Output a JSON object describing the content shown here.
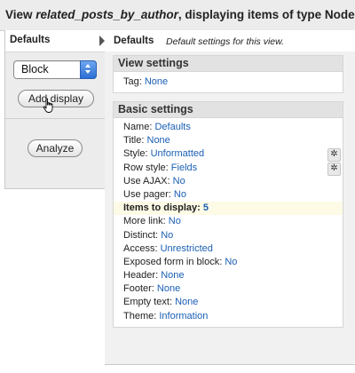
{
  "title": {
    "prefix": "View ",
    "view_name": "related_posts_by_author",
    "suffix": ", displaying items of type Node"
  },
  "left_panel": {
    "tab_label": "Defaults",
    "display_select_value": "Block",
    "add_display_label": "Add display",
    "analyze_label": "Analyze"
  },
  "main": {
    "header_bold": "Defaults",
    "header_desc": "Default settings for this view.",
    "view_settings": {
      "heading": "View settings",
      "rows": [
        {
          "label": "Tag: ",
          "value": "None"
        }
      ]
    },
    "basic_settings": {
      "heading": "Basic settings",
      "rows": [
        {
          "label": "Name: ",
          "value": "Defaults"
        },
        {
          "label": "Title: ",
          "value": "None"
        },
        {
          "label": "Style: ",
          "value": "Unformatted"
        },
        {
          "label": "Row style: ",
          "value": "Fields"
        },
        {
          "label": "Use AJAX: ",
          "value": "No"
        },
        {
          "label": "Use pager: ",
          "value": "No"
        },
        {
          "label": "Items to display: ",
          "value": "5"
        },
        {
          "label": "More link: ",
          "value": "No"
        },
        {
          "label": "Distinct: ",
          "value": "No"
        },
        {
          "label": "Access: ",
          "value": "Unrestricted"
        },
        {
          "label": "Exposed form in block: ",
          "value": "No"
        },
        {
          "label": "Header: ",
          "value": "None"
        },
        {
          "label": "Footer: ",
          "value": "None"
        },
        {
          "label": "Empty text: ",
          "value": "None"
        },
        {
          "label": "Theme: ",
          "value": "Information"
        }
      ]
    }
  },
  "icons": {
    "gear": "gear-icon",
    "tab_arrow": "triangle-right-icon",
    "cursor": "hand-pointer-icon"
  },
  "colors": {
    "link": "#1a5fb4",
    "select_button": "#2b6fd6",
    "highlight_row": "#fdfbe6"
  }
}
